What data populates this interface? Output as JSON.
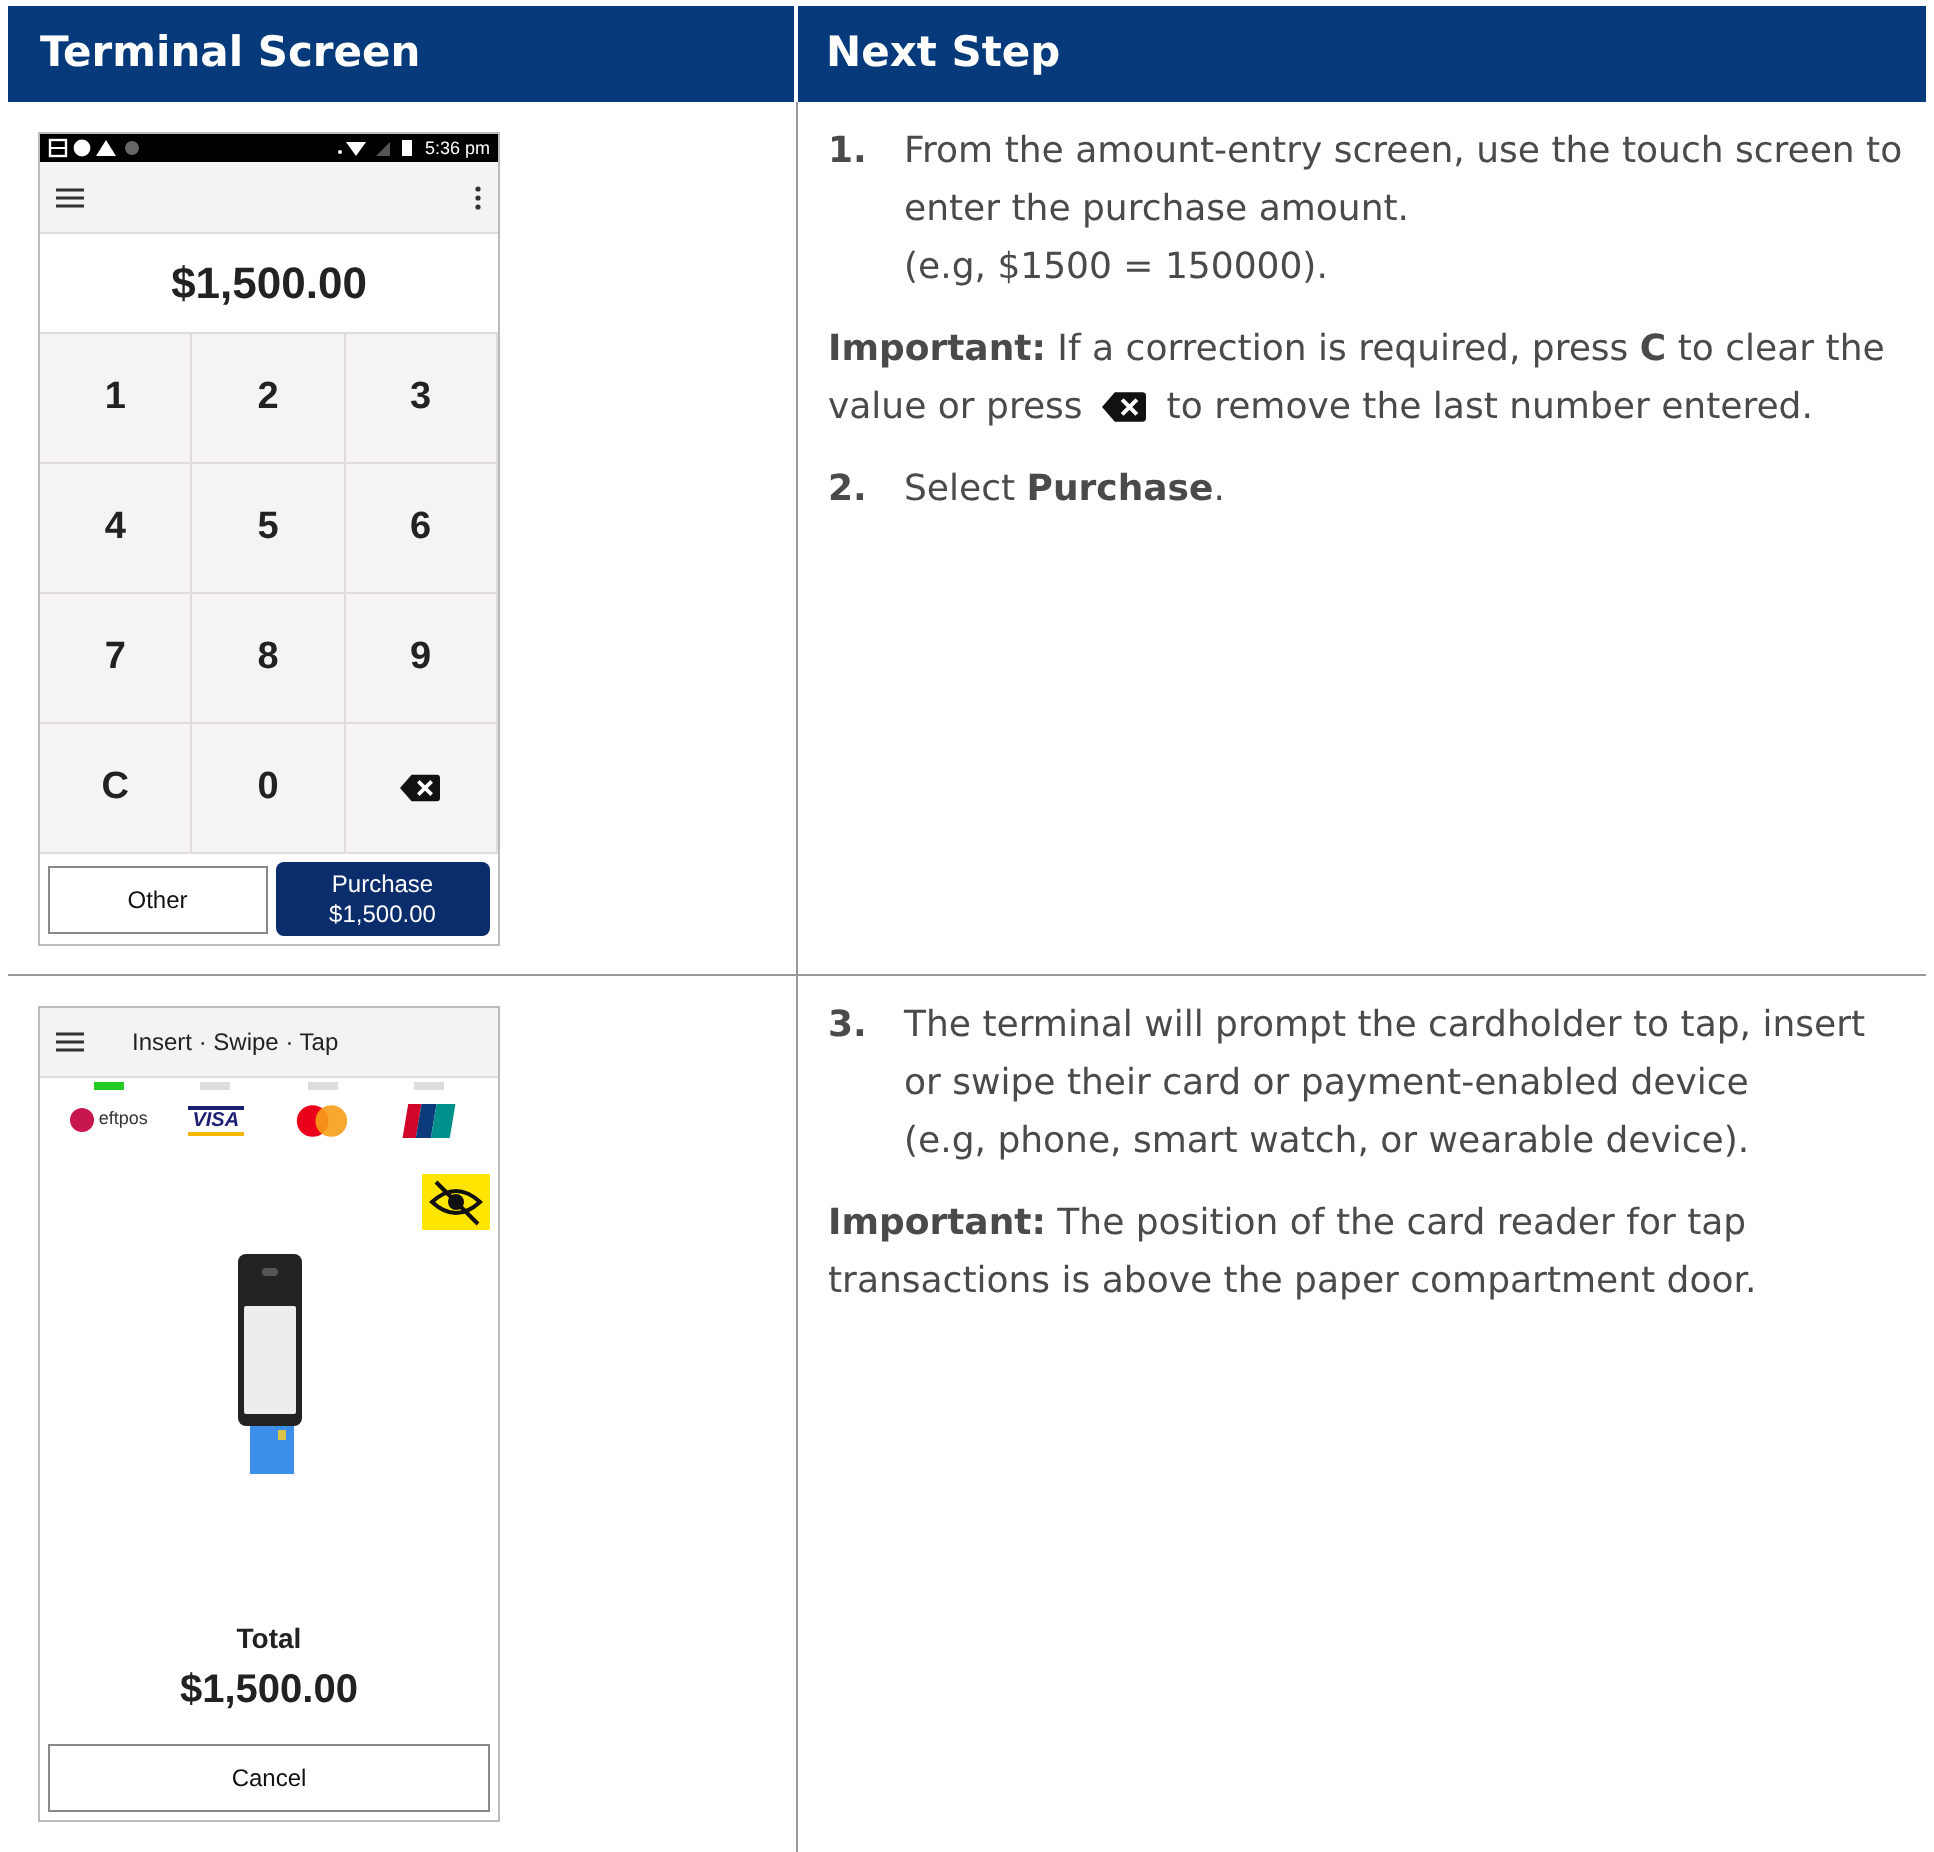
{
  "header": {
    "column_1": "Terminal Screen",
    "column_2": "Next Step"
  },
  "rows": [
    {
      "kind": "keypad",
      "screen": {
        "status_time": "5:36 pm",
        "amount": "$1,500.00",
        "keys": [
          {
            "kind": "digit",
            "label": "1"
          },
          {
            "kind": "digit",
            "label": "2"
          },
          {
            "kind": "digit",
            "label": "3"
          },
          {
            "kind": "digit",
            "label": "4"
          },
          {
            "kind": "digit",
            "label": "5"
          },
          {
            "kind": "digit",
            "label": "6"
          },
          {
            "kind": "digit",
            "label": "7"
          },
          {
            "kind": "digit",
            "label": "8"
          },
          {
            "kind": "digit",
            "label": "9"
          },
          {
            "kind": "digit",
            "label": "C"
          },
          {
            "kind": "digit",
            "label": "0"
          },
          {
            "kind": "backspace"
          }
        ],
        "buttons": [
          {
            "kind": "secondary",
            "label": "Other"
          },
          {
            "kind": "primary",
            "label": "Purchase",
            "amount": "$1,500.00"
          }
        ]
      },
      "steps": [
        {
          "kind": "step",
          "number": "1.",
          "lines": [
            "From the amount-entry screen, use the touch screen to enter the purchase amount.",
            "(e.g, $1500 = 150000)."
          ]
        },
        {
          "kind": "note",
          "parts": [
            "**Important:** If a correction is required, press **C** to clear the",
            "value or press",
            "to remove the last number entered."
          ]
        },
        {
          "kind": "step",
          "number": "2.",
          "lines": [
            "Select **Purchase**."
          ]
        }
      ]
    },
    {
      "kind": "card",
      "screen": {
        "title": "Insert · Swipe · Tap",
        "schemes": [
          {
            "kind": "eftpos",
            "text": "eftpos",
            "selected": true
          },
          {
            "kind": "visa",
            "text": "VISA",
            "selected": false
          },
          {
            "kind": "mastercard",
            "selected": false
          },
          {
            "kind": "unionpay",
            "selected": false
          }
        ],
        "total_label": "Total",
        "amount": "$1,500.00",
        "buttons": [
          {
            "kind": "secondary",
            "label": "Cancel"
          }
        ]
      },
      "steps": [
        {
          "kind": "step",
          "number": "3.",
          "lines": [
            "The terminal will prompt the cardholder to tap, insert or swipe their card or payment-enabled device",
            "(e.g, phone, smart watch, or wearable device)."
          ]
        },
        {
          "kind": "note",
          "parts": [
            "**Important:** The position of the card reader for tap transactions is above the paper compartment door."
          ]
        }
      ]
    }
  ]
}
